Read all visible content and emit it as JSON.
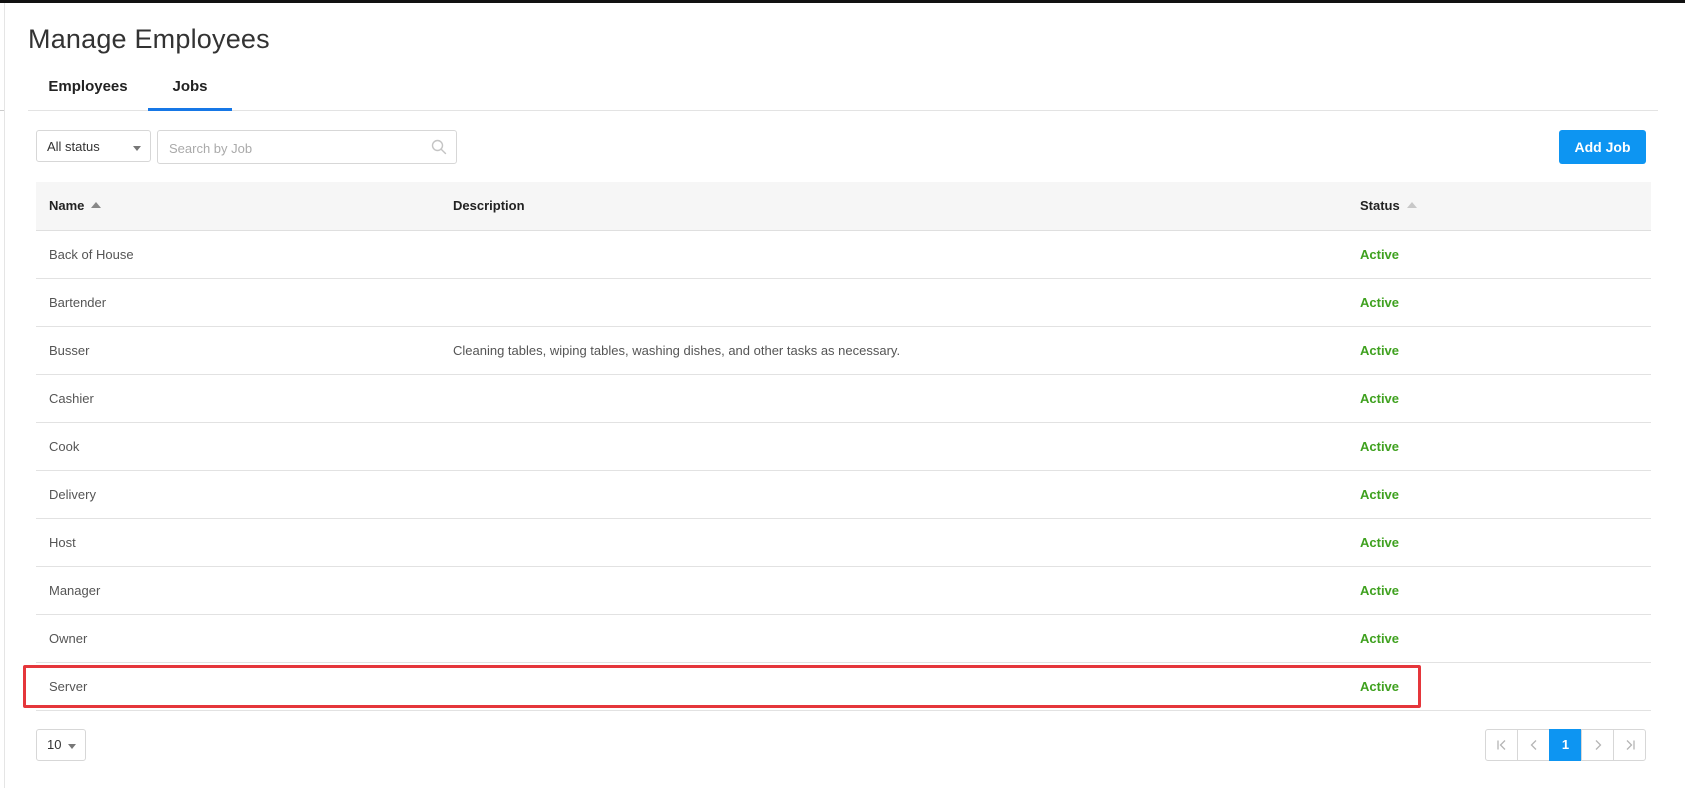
{
  "page": {
    "title": "Manage Employees"
  },
  "tabs": [
    {
      "label": "Employees",
      "active": false
    },
    {
      "label": "Jobs",
      "active": true
    }
  ],
  "filters": {
    "status_value": "All status",
    "search_placeholder": "Search by Job"
  },
  "actions": {
    "add_job_label": "Add Job"
  },
  "table": {
    "columns": [
      "Name",
      "Description",
      "Status"
    ],
    "rows": [
      {
        "name": "Back of House",
        "description": "",
        "status": "Active"
      },
      {
        "name": "Bartender",
        "description": "",
        "status": "Active"
      },
      {
        "name": "Busser",
        "description": "Cleaning tables, wiping tables, washing dishes, and other tasks as necessary.",
        "status": "Active"
      },
      {
        "name": "Cashier",
        "description": "",
        "status": "Active"
      },
      {
        "name": "Cook",
        "description": "",
        "status": "Active"
      },
      {
        "name": "Delivery",
        "description": "",
        "status": "Active"
      },
      {
        "name": "Host",
        "description": "",
        "status": "Active"
      },
      {
        "name": "Manager",
        "description": "",
        "status": "Active"
      },
      {
        "name": "Owner",
        "description": "",
        "status": "Active"
      },
      {
        "name": "Server",
        "description": "",
        "status": "Active"
      }
    ],
    "highlighted_row": "Server"
  },
  "pagination": {
    "page_size": "10",
    "current_page": "1"
  },
  "colors": {
    "accent": "#0d95f2",
    "tab_underline": "#1677e6",
    "status_active": "#3fa11f",
    "highlight_border": "#e5363b"
  },
  "icons": [
    "search-icon",
    "chevron-down-icon",
    "sort-asc-icon",
    "first-page-icon",
    "prev-page-icon",
    "next-page-icon",
    "last-page-icon"
  ]
}
